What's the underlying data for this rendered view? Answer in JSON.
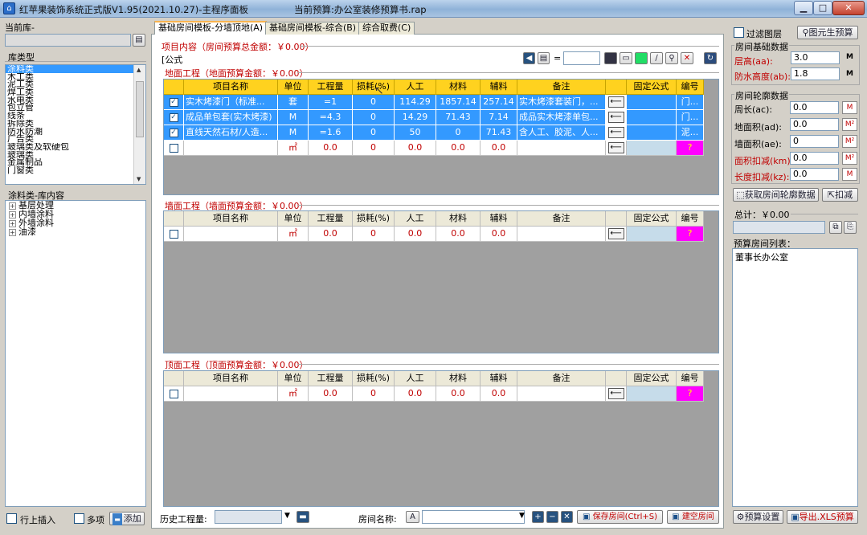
{
  "window": {
    "app_title": "红苹果装饰系统正式版V1.95(2021.10.27)-主程序面板",
    "budget_title": "当前预算:办公室装修预算书.rap",
    "min": "▁",
    "max": "□",
    "close": "✕"
  },
  "left": {
    "current_lib_label": "当前库-",
    "lib_type_label": "库类型",
    "lib_types": [
      "涂料类",
      "木工类",
      "泥工类",
      "焊工类",
      "水电类",
      "包立管",
      "线条",
      "拆除类",
      "防水防潮",
      "广告类",
      "玻璃类及软硬包",
      "玻璃类",
      "金属制品",
      "门窗类"
    ],
    "paint_lib_label": "涂料类-库内容",
    "tree": [
      "基层处理",
      "内墙涂料",
      "外墙涂料",
      "油漆"
    ],
    "insert_label": "行上插入",
    "multi_label": "多项",
    "add_label": "添加"
  },
  "tabs": [
    "基础房间模板-分墙顶地(A)",
    "基础房间模板-综合(B)",
    "综合取费(C)"
  ],
  "project": {
    "title": "项目内容（房间预算总金额：￥0.00）",
    "formula_label": "[公式",
    "eq": "="
  },
  "columns": [
    "项目名称",
    "单位",
    "工程量",
    "损耗(%)",
    "人工",
    "材料",
    "辅料",
    "备注",
    "",
    "固定公式",
    "编号"
  ],
  "floor": {
    "title": "地面工程（地面预算金额：￥0.00）",
    "rows": [
      {
        "name": "实木烤漆门（标准...",
        "unit": "套",
        "qty": "=1",
        "loss": "0",
        "labor": "114.29",
        "material": "1857.14",
        "aux": "257.14",
        "note": "实木烤漆套装门，...",
        "code": "门..."
      },
      {
        "name": "成品单包套(实木烤漆)",
        "unit": "M",
        "qty": "=4.3",
        "loss": "0",
        "labor": "14.29",
        "material": "71.43",
        "aux": "7.14",
        "note": "成品实木烤漆单包...",
        "code": "门..."
      },
      {
        "name": "直线天然石材/人造...",
        "unit": "M",
        "qty": "=1.6",
        "loss": "0",
        "labor": "50",
        "material": "0",
        "aux": "71.43",
        "note": "含人工、胶泥、人...",
        "code": "泥..."
      }
    ],
    "new_row": {
      "unit": "㎡",
      "qty": "0.0",
      "loss": "0",
      "labor": "0.0",
      "material": "0.0",
      "aux": "0.0",
      "code": "?"
    }
  },
  "wall": {
    "title": "墙面工程（墙面预算金额：￥0.00）",
    "new_row": {
      "unit": "㎡",
      "qty": "0.0",
      "loss": "0",
      "labor": "0.0",
      "material": "0.0",
      "aux": "0.0",
      "code": "?"
    }
  },
  "ceiling": {
    "title": "顶面工程（顶面预算金额：￥0.00）",
    "new_row": {
      "unit": "㎡",
      "qty": "0.0",
      "loss": "0",
      "labor": "0.0",
      "material": "0.0",
      "aux": "0.0",
      "code": "?"
    }
  },
  "bottom": {
    "history_label": "历史工程量:",
    "room_name_label": "房间名称:",
    "save_room": "保存房间(Ctrl+S)",
    "empty_room": "建空房间"
  },
  "right": {
    "filter_label": "过滤图层",
    "generate_label": "图元生预算",
    "basic_data_label": "房间基础数据",
    "height_label": "层高(aa):",
    "height_value": "3.0",
    "height_unit": "M",
    "waterproof_label": "防水高度(ab):",
    "waterproof_value": "1.8",
    "waterproof_unit": "M",
    "contour_label": "房间轮廓数据",
    "perimeter_label": "周长(ac):",
    "perimeter_value": "0.0",
    "perimeter_unit": "M",
    "floor_area_label": "地面积(ad):",
    "floor_area_value": "0.0",
    "floor_area_unit": "M²",
    "wall_area_label": "墙面积(ae):",
    "wall_area_value": "0",
    "wall_area_unit": "M²",
    "area_deduct_label": "面积扣减(km):",
    "area_deduct_value": "0.0",
    "area_deduct_unit": "M²",
    "length_deduct_label": "长度扣减(kz):",
    "length_deduct_value": "0.0",
    "length_deduct_unit": "M",
    "get_contour": "获取房间轮廓数据",
    "deduct": "扣减",
    "total_label": "总计：￥0.00",
    "room_list_label": "预算房间列表：",
    "rooms": [
      "董事长办公室"
    ],
    "settings_label": "预算设置",
    "export_label": "导出.XLS预算"
  }
}
